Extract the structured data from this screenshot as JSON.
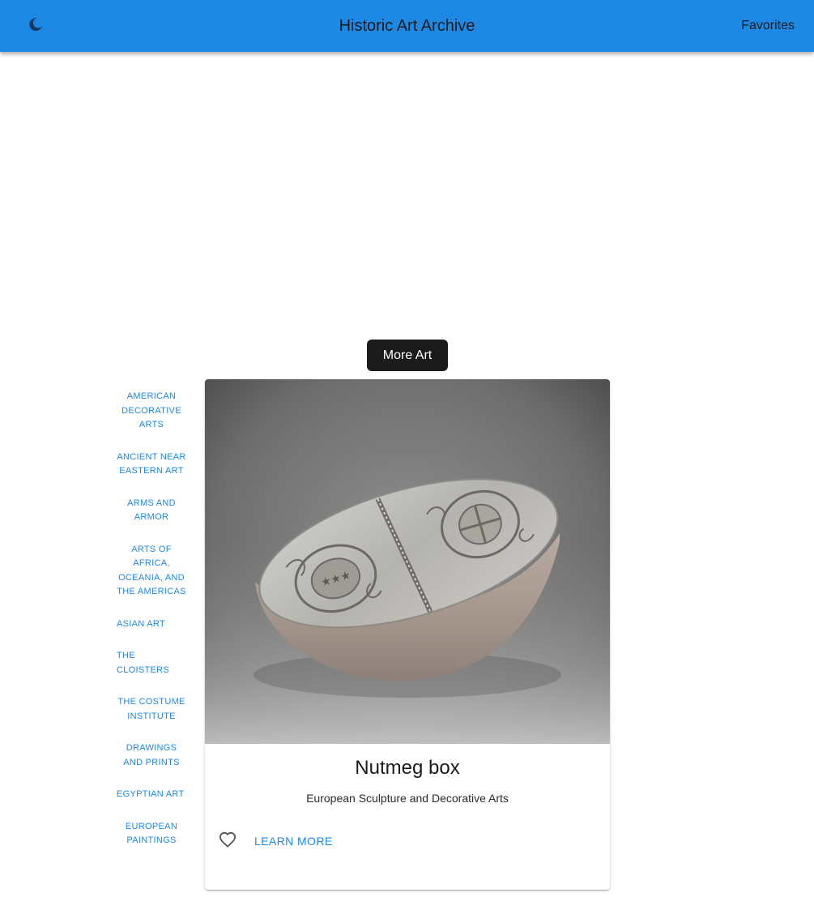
{
  "colors": {
    "app_bar": "#1e88e5",
    "accent": "#1e88e5",
    "primary_button_bg": "#1b1b1b",
    "primary_button_text": "#ffffff"
  },
  "header": {
    "title": "Historic Art Archive",
    "favorites_label": "Favorites",
    "theme_toggle_icon": "moon-icon"
  },
  "more_art_label": "More Art",
  "departments": [
    "American Decorative Arts",
    "Ancient Near Eastern Art",
    "Arms and Armor",
    "Arts of Africa, Oceania, and the Americas",
    "Asian Art",
    "The Cloisters",
    "The Costume Institute",
    "Drawings and Prints",
    "Egyptian Art",
    "European Paintings"
  ],
  "card": {
    "title": "Nutmeg box",
    "department": "European Sculpture and Decorative Arts",
    "learn_more_label": "Learn More",
    "favorite_icon": "heart-outline-icon"
  }
}
